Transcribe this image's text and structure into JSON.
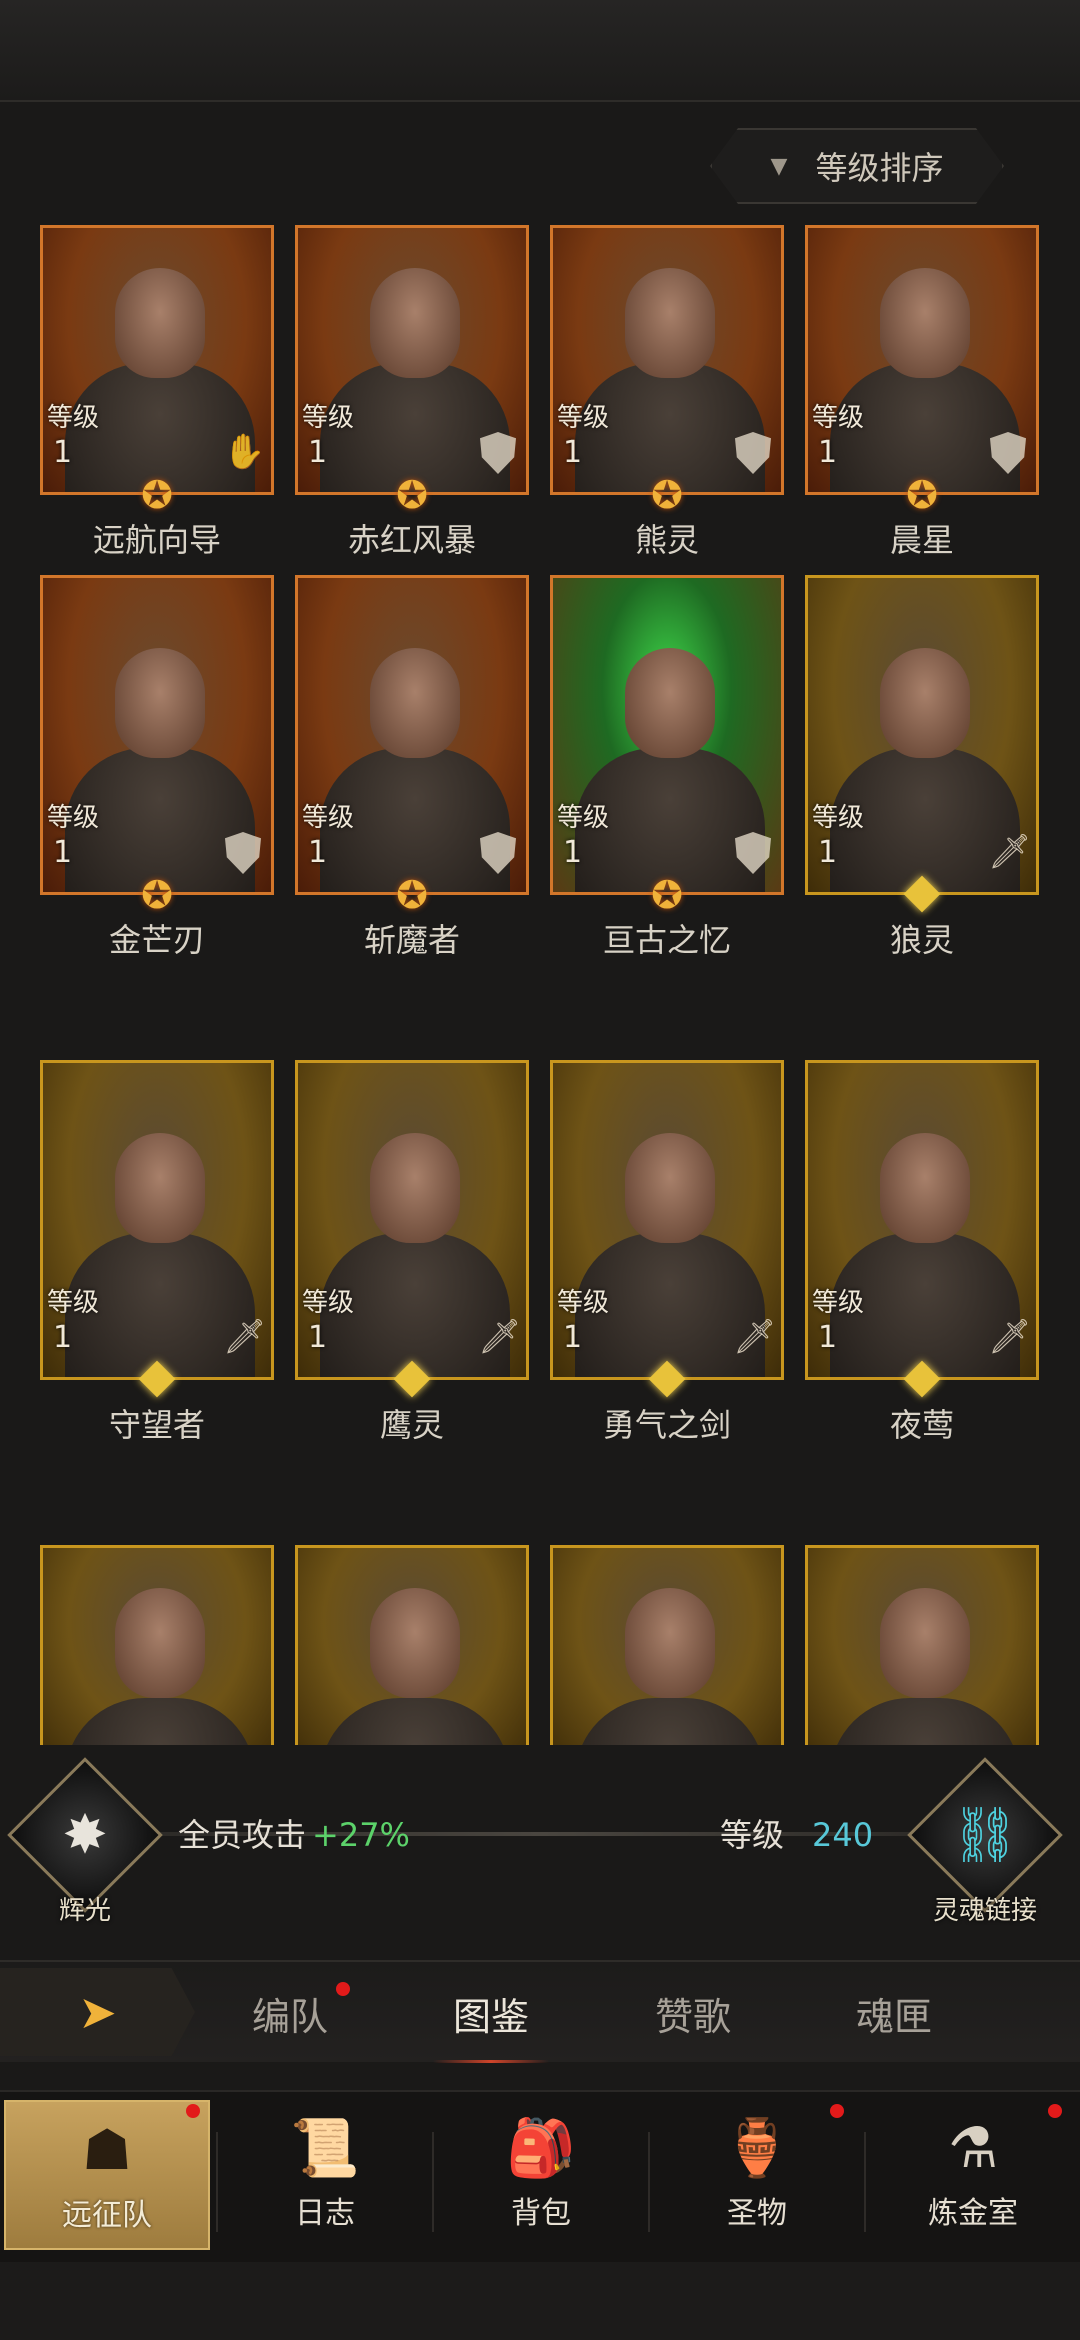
{
  "sort_button": {
    "label": "等级排序"
  },
  "level_label": "等级",
  "heroes": [
    {
      "name": "远航向导",
      "level": "1",
      "frame": "orange",
      "class_icon": "palm-icon"
    },
    {
      "name": "赤红风暴",
      "level": "1",
      "frame": "orange",
      "class_icon": "shield-icon"
    },
    {
      "name": "熊灵",
      "level": "1",
      "frame": "orange",
      "class_icon": "shield-icon"
    },
    {
      "name": "晨星",
      "level": "1",
      "frame": "orange",
      "class_icon": "shield-icon"
    },
    {
      "name": "金芒刃",
      "level": "1",
      "frame": "orange",
      "class_icon": "shield-icon"
    },
    {
      "name": "斩魔者",
      "level": "1",
      "frame": "orange",
      "class_icon": "shield-icon"
    },
    {
      "name": "亘古之忆",
      "level": "1",
      "frame": "green",
      "class_icon": "shield-icon"
    },
    {
      "name": "狼灵",
      "level": "1",
      "frame": "gold",
      "class_icon": "sword-icon"
    },
    {
      "name": "守望者",
      "level": "1",
      "frame": "gold",
      "class_icon": "sword-icon"
    },
    {
      "name": "鹰灵",
      "level": "1",
      "frame": "gold",
      "class_icon": "sword-icon"
    },
    {
      "name": "勇气之剑",
      "level": "1",
      "frame": "gold",
      "class_icon": "sword-icon"
    },
    {
      "name": "夜莺",
      "level": "1",
      "frame": "gold",
      "class_icon": "sword-icon"
    }
  ],
  "bonus": {
    "left_emblem_label": "辉光",
    "attack_label": "全员攻击",
    "attack_value": "+27%",
    "level_label": "等级",
    "level_value": "240",
    "right_emblem_label": "灵魂链接"
  },
  "tabs": [
    "编队",
    "图鉴",
    "赞歌",
    "魂匣"
  ],
  "active_tab": "图鉴",
  "bottom_nav": [
    "远征队",
    "日志",
    "背包",
    "圣物",
    "炼金室"
  ],
  "colors": {
    "accent_gold": "#f0b23a",
    "bonus_green": "#5cd26a",
    "level_cyan": "#58c8d8",
    "badge_red": "#e21a1a"
  }
}
